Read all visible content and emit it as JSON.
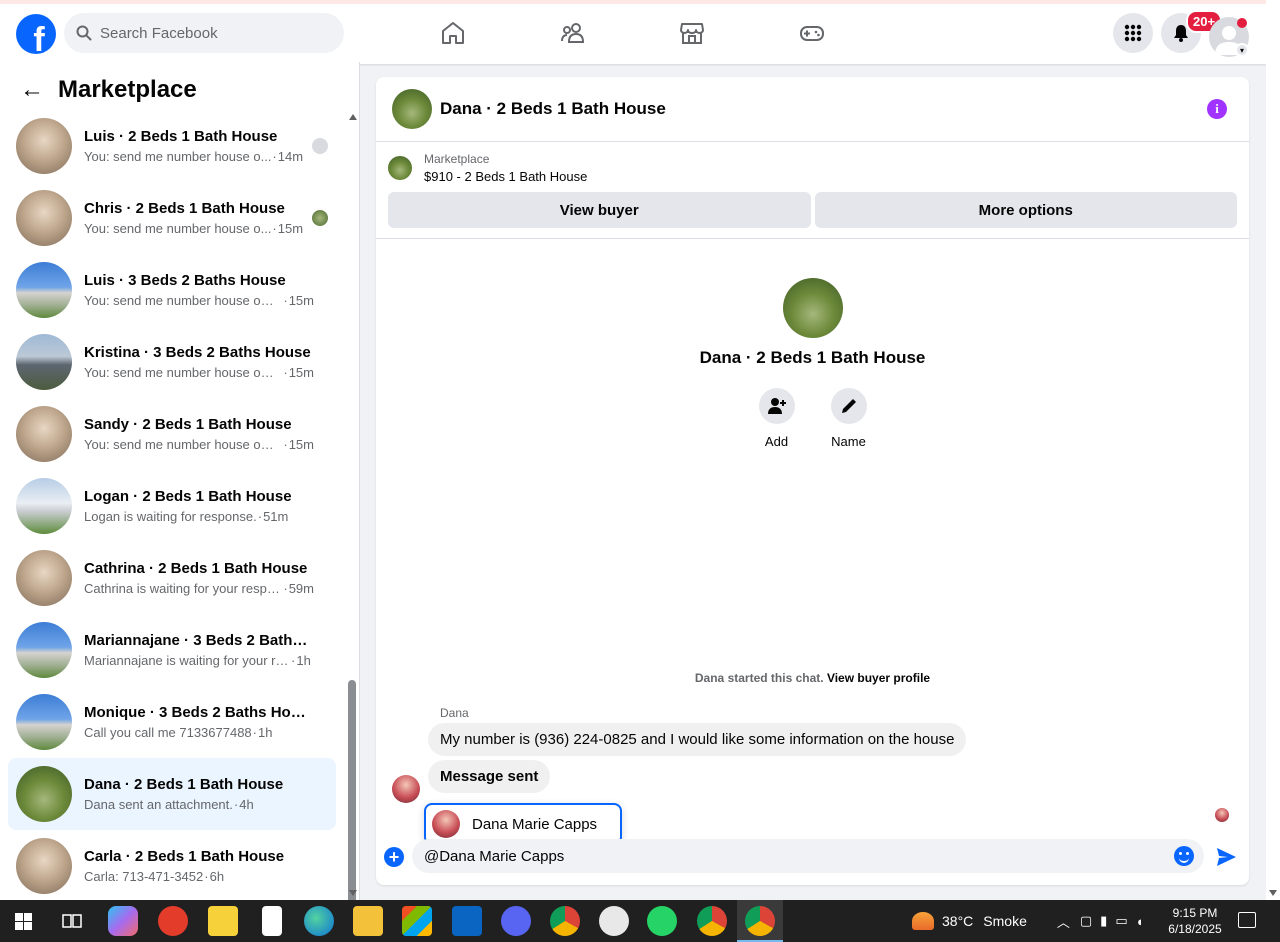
{
  "topbar": {
    "logo": "f",
    "search_placeholder": "Search Facebook",
    "notification_count": "20+",
    "icons": [
      "home-icon",
      "friends-icon",
      "marketplace-icon",
      "gaming-icon",
      "menu-grid-icon",
      "bell-icon",
      "account-icon"
    ]
  },
  "sidebar": {
    "title": "Marketplace",
    "back_icon": "←",
    "conversations": [
      {
        "name": "Luis · 2 Beds 1 Bath House",
        "snippet": "You: send me number house o...",
        "time": "14m",
        "thumb": "interior"
      },
      {
        "name": "Chris · 2 Beds 1 Bath House",
        "snippet": "You: send me number house o...",
        "time": "15m",
        "thumb": "interior"
      },
      {
        "name": "Luis · 3 Beds 2 Baths House",
        "snippet": "You: send me number house own...",
        "time": "15m",
        "thumb": "blue"
      },
      {
        "name": "Kristina · 3 Beds 2 Baths House",
        "snippet": "You: send me number house own...",
        "time": "15m",
        "thumb": "grey"
      },
      {
        "name": "Sandy · 2 Beds 1 Bath House",
        "snippet": "You: send me number house own...",
        "time": "15m",
        "thumb": "interior"
      },
      {
        "name": "Logan · 2 Beds 1 Bath House",
        "snippet": "Logan is waiting for response.",
        "time": "51m",
        "thumb": "white"
      },
      {
        "name": "Cathrina · 2 Beds 1 Bath House",
        "snippet": "Cathrina is waiting for your respo...",
        "time": "59m",
        "thumb": "interior"
      },
      {
        "name": "Mariannajane · 3 Beds 2 Baths H...",
        "snippet": "Mariannajane is waiting for your re...",
        "time": "1h",
        "thumb": "blue"
      },
      {
        "name": "Monique · 3 Beds 2 Baths House",
        "snippet": "Call you call me 7133677488",
        "time": "1h",
        "thumb": "blue"
      },
      {
        "name": "Dana · 2 Beds 1 Bath House",
        "snippet": "Dana sent an attachment.",
        "time": "4h",
        "thumb": "forest",
        "active": true
      },
      {
        "name": "Carla · 2 Beds 1 Bath House",
        "snippet": "Carla: 713-471-3452",
        "time": "6h",
        "thumb": "interior"
      }
    ]
  },
  "chat": {
    "title": "Dana · 2 Beds 1 Bath House",
    "listing_source": "Marketplace",
    "listing_price_title": "$910 - 2 Beds 1 Bath House",
    "view_buyer": "View buyer",
    "more_options": "More options",
    "profile_name": "Dana · 2 Beds 1 Bath House",
    "add_label": "Add",
    "name_label": "Name",
    "started_text": "Dana started this chat.",
    "view_buyer_profile": "View buyer profile",
    "sender_name": "Dana",
    "messages": [
      "My number is (936) 224-0825 and I would like some information on the house",
      "Message sent"
    ],
    "mention_suggestion": "Dana Marie Capps",
    "composer_value": "@Dana Marie Capps"
  },
  "tray": {
    "temperature": "38°C",
    "weather": "Smoke",
    "time": "9:15 PM",
    "date": "6/18/2025"
  },
  "colors": {
    "facebook_blue": "#0866ff",
    "active_row": "#ebf5ff",
    "info_purple": "#a033ff",
    "badge_red": "#e41e3f"
  }
}
